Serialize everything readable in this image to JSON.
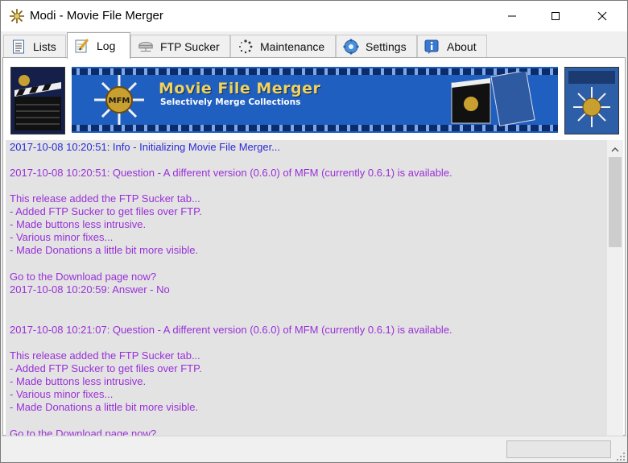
{
  "window": {
    "title": "Modi - Movie File Merger"
  },
  "tabs": [
    {
      "label": "Lists",
      "icon": "document-list-icon"
    },
    {
      "label": "Log",
      "icon": "notepad-pencil-icon"
    },
    {
      "label": "FTP Sucker",
      "icon": "network-drive-icon"
    },
    {
      "label": "Maintenance",
      "icon": "spinner-icon"
    },
    {
      "label": "Settings",
      "icon": "gear-icon"
    },
    {
      "label": "About",
      "icon": "info-icon"
    }
  ],
  "active_tab": "Log",
  "banner": {
    "title": "Movie File Merger",
    "subtitle": "Selectively Merge Collections",
    "logo_text": "MFM"
  },
  "log": {
    "lines": [
      {
        "text": "2017-10-08 10:20:51: Info - Initializing Movie File Merger...",
        "kind": "info"
      },
      {
        "text": "2017-10-08 10:20:51: Question - A different version (0.6.0) of MFM (currently 0.6.1) is available.",
        "kind": "question"
      },
      {
        "text": "This release added the FTP Sucker tab...",
        "kind": "question"
      },
      {
        "text": "- Added FTP Sucker to get files over FTP.",
        "kind": "question"
      },
      {
        "text": "- Made buttons less intrusive.",
        "kind": "question"
      },
      {
        "text": "- Various minor fixes...",
        "kind": "question"
      },
      {
        "text": "- Made Donations a little bit more visible.",
        "kind": "question"
      },
      {
        "text": "Go to the Download page now?",
        "kind": "question"
      },
      {
        "text": "2017-10-08 10:20:59: Answer - No",
        "kind": "question"
      },
      {
        "text": "2017-10-08 10:21:07: Question - A different version (0.6.0) of MFM (currently 0.6.1) is available.",
        "kind": "question"
      },
      {
        "text": "This release added the FTP Sucker tab...",
        "kind": "question"
      },
      {
        "text": "- Added FTP Sucker to get files over FTP.",
        "kind": "question"
      },
      {
        "text": "- Made buttons less intrusive.",
        "kind": "question"
      },
      {
        "text": "- Various minor fixes...",
        "kind": "question"
      },
      {
        "text": "- Made Donations a little bit more visible.",
        "kind": "question"
      },
      {
        "text": "Go to the Download page now?",
        "kind": "question"
      }
    ]
  },
  "colors": {
    "info_text": "#2b2bd8",
    "question_text": "#9a30d8",
    "log_background": "#e3e3e3",
    "banner_blue": "#1f5fc0",
    "banner_gold": "#f0d25c"
  }
}
